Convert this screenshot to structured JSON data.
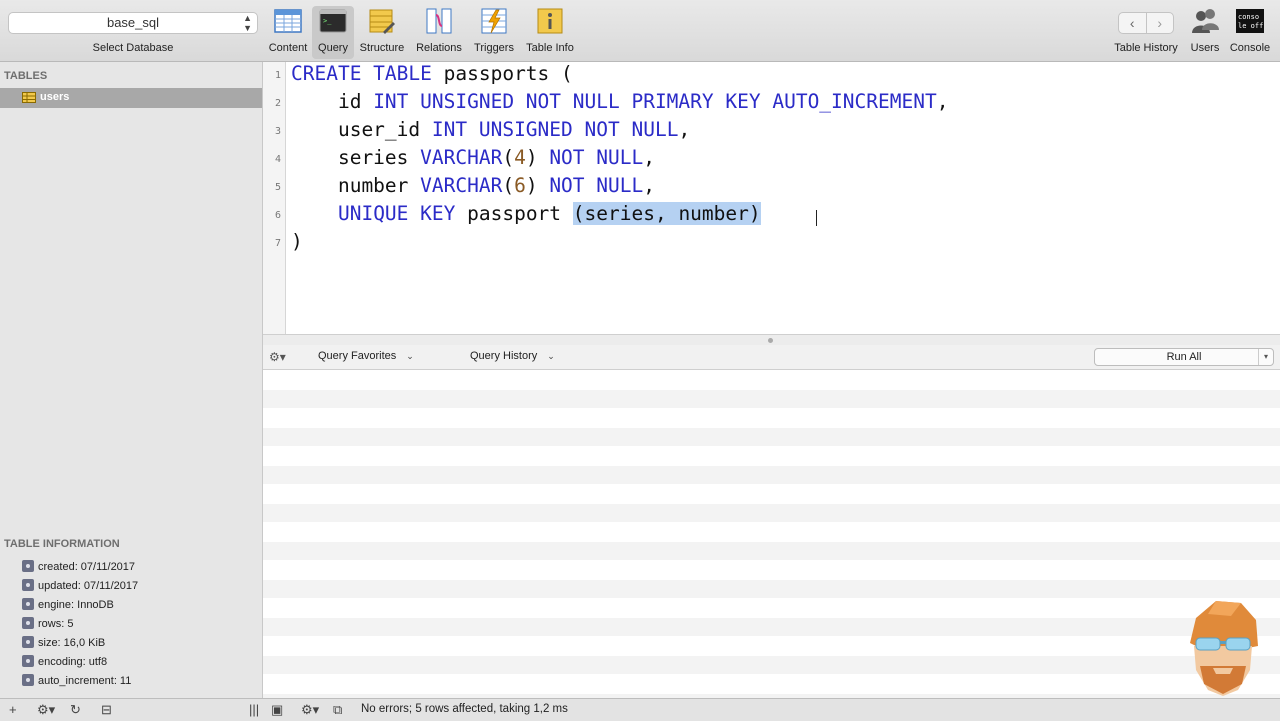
{
  "toolbar": {
    "database": "base_sql",
    "select_database_label": "Select Database",
    "tools": [
      {
        "label": "Content",
        "icon": "content-table-icon"
      },
      {
        "label": "Query",
        "icon": "query-terminal-icon"
      },
      {
        "label": "Structure",
        "icon": "structure-icon"
      },
      {
        "label": "Relations",
        "icon": "relations-icon"
      },
      {
        "label": "Triggers",
        "icon": "triggers-icon"
      },
      {
        "label": "Table Info",
        "icon": "table-info-icon"
      }
    ],
    "active_tool": "Query",
    "right": [
      {
        "label": "Table History",
        "icon": "back-forward-icon"
      },
      {
        "label": "Users",
        "icon": "users-icon"
      },
      {
        "label": "Console",
        "icon": "console-icon"
      }
    ],
    "console_icon_text": [
      "conso",
      "le off"
    ]
  },
  "sidebar": {
    "tables_title": "TABLES",
    "tables": [
      "users"
    ],
    "info_title": "TABLE INFORMATION",
    "info": [
      "created: 07/11/2017",
      "updated: 07/11/2017",
      "engine: InnoDB",
      "rows: 5",
      "size: 16,0 KiB",
      "encoding: utf8",
      "auto_increment: 11"
    ]
  },
  "editor": {
    "line_numbers": [
      "1",
      "2",
      "3",
      "4",
      "5",
      "6",
      "7"
    ],
    "lines": {
      "l1": {
        "kw": "CREATE TABLE",
        "rest": " passports ("
      },
      "l2": {
        "ident": "    id ",
        "kw": "INT UNSIGNED NOT NULL PRIMARY KEY AUTO_INCREMENT",
        "rest": ","
      },
      "l3": {
        "ident": "    user_id ",
        "kw": "INT UNSIGNED NOT NULL",
        "rest": ","
      },
      "l4": {
        "ident": "    series ",
        "kw1": "VARCHAR",
        "open": "(",
        "num": "4",
        "close": ") ",
        "kw2": "NOT NULL",
        "rest": ","
      },
      "l5": {
        "ident": "    number ",
        "kw1": "VARCHAR",
        "open": "(",
        "num": "6",
        "close": ") ",
        "kw2": "NOT NULL",
        "rest": ","
      },
      "l6": {
        "indent": "    ",
        "kw": "UNIQUE KEY",
        "mid": " passport ",
        "selected": "(series, number)"
      },
      "l7": {
        "rest": ")"
      }
    }
  },
  "query_bar": {
    "favorites": "Query Favorites",
    "history": "Query History",
    "run_all": "Run All"
  },
  "status": {
    "message": "No errors; 5 rows affected, taking 1,2 ms"
  },
  "colors": {
    "keyword": "#2b2bc7",
    "number": "#8a5a24",
    "selection": "#b5d1f2",
    "sidebar_selected": "#a8a8a8"
  }
}
